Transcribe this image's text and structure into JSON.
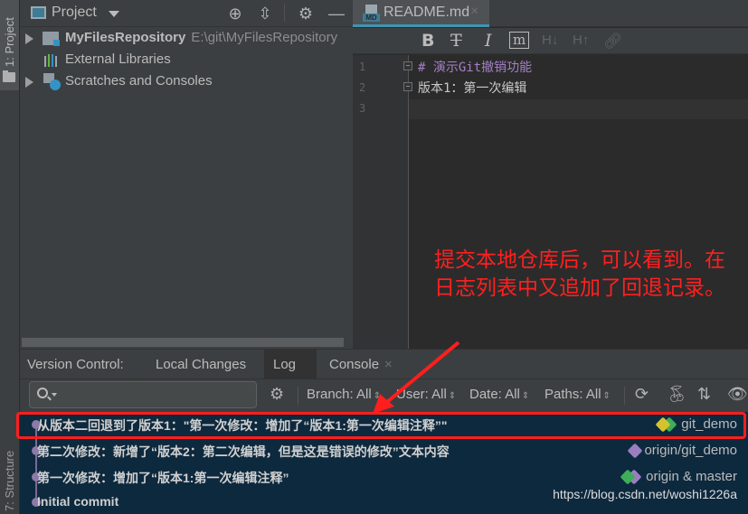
{
  "sidebar_strip": {
    "project_tab": "1: Project",
    "structure_tab": "7: Structure"
  },
  "project_panel": {
    "title": "Project",
    "tree": [
      {
        "label": "MyFilesRepository",
        "path": "E:\\git\\MyFilesRepository",
        "expandable": true,
        "icon": "module-folder-icon"
      },
      {
        "label": "External Libraries",
        "expandable": false,
        "icon": "libraries-icon"
      },
      {
        "label": "Scratches and Consoles",
        "expandable": true,
        "icon": "scratches-icon"
      }
    ]
  },
  "editor": {
    "tab": {
      "title": "README.md",
      "icon": "markdown-file-icon"
    },
    "toolbar": [
      "B",
      "T",
      "I",
      "m",
      "H↓",
      "H↑",
      "link"
    ],
    "lines": [
      {
        "number": "1",
        "text": "# 演示Git撤销功能",
        "style": "heading"
      },
      {
        "number": "2",
        "text": "版本1：第一次编辑",
        "style": "plain"
      },
      {
        "number": "3",
        "text": "",
        "style": "plain"
      }
    ]
  },
  "annotation": {
    "text": "提交本地仓库后，可以看到。在日志列表中又追加了回退记录。",
    "color": "#ff2020"
  },
  "version_control": {
    "label": "Version Control:",
    "tabs": [
      {
        "label": "Local Changes",
        "active": false
      },
      {
        "label": "Log",
        "active": true
      },
      {
        "label": "Console",
        "active": false,
        "closable": true
      }
    ],
    "search": {
      "placeholder": ""
    },
    "filters": [
      {
        "label": "Branch: All"
      },
      {
        "label": "User: All"
      },
      {
        "label": "Date: All"
      },
      {
        "label": "Paths: All"
      }
    ],
    "commits": [
      {
        "message": "从版本二回退到了版本1：\"第一次修改：增加了“版本1:第一次编辑注释”\"",
        "refs": "git_demo",
        "highlighted": true
      },
      {
        "message": "第二次修改：新增了“版本2：第二次编辑，但是这是错误的修改”文本内容",
        "refs": "origin/git_demo",
        "highlighted": false
      },
      {
        "message": "第一次修改：增加了“版本1:第一次编辑注释”",
        "refs": "origin & master",
        "highlighted": false
      },
      {
        "message": "Initial commit",
        "refs": "",
        "highlighted": false
      }
    ],
    "watermark": "https://blog.csdn.net/woshi1226a"
  },
  "colors": {
    "tag_yellow": "#d6c22d",
    "tag_green": "#3fae5a",
    "tag_purple": "#9a7ec0",
    "highlight_red": "#ff1e1e"
  }
}
